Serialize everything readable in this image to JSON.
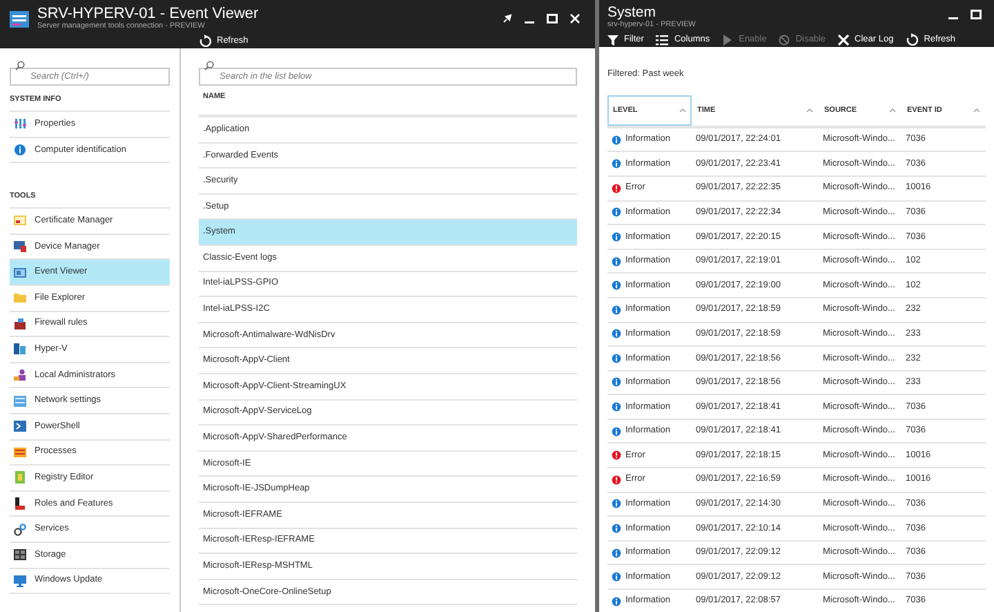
{
  "blade": {
    "title": "SRV-HYPERV-01 - Event Viewer",
    "subtitle": "Server management tools connection - PREVIEW",
    "toolbar": [
      {
        "label": "Refresh",
        "kind": "refresh"
      }
    ]
  },
  "sidebar": {
    "search_placeholder": "Search (Ctrl+/)",
    "sections": [
      {
        "heading": "SYSTEM INFO",
        "items": [
          {
            "label": "Properties",
            "kind": "properties",
            "selected": false
          },
          {
            "label": "Computer identification",
            "kind": "info",
            "selected": false
          }
        ]
      },
      {
        "heading": "TOOLS",
        "items": [
          {
            "label": "Certificate Manager",
            "kind": "certificate",
            "selected": false
          },
          {
            "label": "Device Manager",
            "kind": "device",
            "selected": false
          },
          {
            "label": "Event Viewer",
            "kind": "event",
            "selected": true
          },
          {
            "label": "File Explorer",
            "kind": "folder",
            "selected": false
          },
          {
            "label": "Firewall rules",
            "kind": "firewall",
            "selected": false
          },
          {
            "label": "Hyper-V",
            "kind": "hyperv",
            "selected": false
          },
          {
            "label": "Local Administrators",
            "kind": "users",
            "selected": false
          },
          {
            "label": "Network settings",
            "kind": "network",
            "selected": false
          },
          {
            "label": "PowerShell",
            "kind": "powershell",
            "selected": false
          },
          {
            "label": "Processes",
            "kind": "processes",
            "selected": false
          },
          {
            "label": "Registry Editor",
            "kind": "registry",
            "selected": false
          },
          {
            "label": "Roles and Features",
            "kind": "roles",
            "selected": false
          },
          {
            "label": "Services",
            "kind": "services",
            "selected": false
          },
          {
            "label": "Storage",
            "kind": "storage",
            "selected": false
          },
          {
            "label": "Windows Update",
            "kind": "update",
            "selected": false
          }
        ]
      }
    ]
  },
  "logs": {
    "search_placeholder": "Search in the list below",
    "column": "NAME",
    "items": [
      {
        "label": ".Application",
        "selected": false
      },
      {
        "label": ".Forwarded Events",
        "selected": false
      },
      {
        "label": ".Security",
        "selected": false
      },
      {
        "label": ".Setup",
        "selected": false
      },
      {
        "label": ".System",
        "selected": true
      },
      {
        "label": "Classic-Event logs",
        "selected": false
      },
      {
        "label": "Intel-iaLPSS-GPIO",
        "selected": false
      },
      {
        "label": "Intel-iaLPSS-I2C",
        "selected": false
      },
      {
        "label": "Microsoft-Antimalware-WdNisDrv",
        "selected": false
      },
      {
        "label": "Microsoft-AppV-Client",
        "selected": false
      },
      {
        "label": "Microsoft-AppV-Client-StreamingUX",
        "selected": false
      },
      {
        "label": "Microsoft-AppV-ServiceLog",
        "selected": false
      },
      {
        "label": "Microsoft-AppV-SharedPerformance",
        "selected": false
      },
      {
        "label": "Microsoft-IE",
        "selected": false
      },
      {
        "label": "Microsoft-IE-JSDumpHeap",
        "selected": false
      },
      {
        "label": "Microsoft-IEFRAME",
        "selected": false
      },
      {
        "label": "Microsoft-IEResp-IEFRAME",
        "selected": false
      },
      {
        "label": "Microsoft-IEResp-MSHTML",
        "selected": false
      },
      {
        "label": "Microsoft-OneCore-OnlineSetup",
        "selected": false
      }
    ]
  },
  "system": {
    "title": "System",
    "subtitle": "srv-hyperv-01 - PREVIEW",
    "toolbar": [
      {
        "label": "Filter",
        "kind": "filter",
        "disabled": false
      },
      {
        "label": "Columns",
        "kind": "columns",
        "disabled": false
      },
      {
        "label": "Enable",
        "kind": "play",
        "disabled": true
      },
      {
        "label": "Disable",
        "kind": "block",
        "disabled": true
      },
      {
        "label": "Clear Log",
        "kind": "close",
        "disabled": false
      },
      {
        "label": "Refresh",
        "kind": "refresh",
        "disabled": false
      }
    ],
    "filter_text": "Filtered: Past week",
    "columns": [
      {
        "label": "LEVEL",
        "focused": true
      },
      {
        "label": "TIME",
        "focused": false
      },
      {
        "label": "SOURCE",
        "focused": false
      },
      {
        "label": "EVENT ID",
        "focused": false
      }
    ],
    "rows": [
      {
        "kind": "information",
        "level": "Information",
        "time": "09/01/2017, 22:24:01",
        "source": "Microsoft-Windo...",
        "event_id": "7036"
      },
      {
        "kind": "information",
        "level": "Information",
        "time": "09/01/2017, 22:23:41",
        "source": "Microsoft-Windo...",
        "event_id": "7036"
      },
      {
        "kind": "error",
        "level": "Error",
        "time": "09/01/2017, 22:22:35",
        "source": "Microsoft-Windo...",
        "event_id": "10016"
      },
      {
        "kind": "information",
        "level": "Information",
        "time": "09/01/2017, 22:22:34",
        "source": "Microsoft-Windo...",
        "event_id": "7036"
      },
      {
        "kind": "information",
        "level": "Information",
        "time": "09/01/2017, 22:20:15",
        "source": "Microsoft-Windo...",
        "event_id": "7036"
      },
      {
        "kind": "information",
        "level": "Information",
        "time": "09/01/2017, 22:19:01",
        "source": "Microsoft-Windo...",
        "event_id": "102"
      },
      {
        "kind": "information",
        "level": "Information",
        "time": "09/01/2017, 22:19:00",
        "source": "Microsoft-Windo...",
        "event_id": "102"
      },
      {
        "kind": "information",
        "level": "Information",
        "time": "09/01/2017, 22:18:59",
        "source": "Microsoft-Windo...",
        "event_id": "232"
      },
      {
        "kind": "information",
        "level": "Information",
        "time": "09/01/2017, 22:18:59",
        "source": "Microsoft-Windo...",
        "event_id": "233"
      },
      {
        "kind": "information",
        "level": "Information",
        "time": "09/01/2017, 22:18:56",
        "source": "Microsoft-Windo...",
        "event_id": "232"
      },
      {
        "kind": "information",
        "level": "Information",
        "time": "09/01/2017, 22:18:56",
        "source": "Microsoft-Windo...",
        "event_id": "233"
      },
      {
        "kind": "information",
        "level": "Information",
        "time": "09/01/2017, 22:18:41",
        "source": "Microsoft-Windo...",
        "event_id": "7036"
      },
      {
        "kind": "information",
        "level": "Information",
        "time": "09/01/2017, 22:18:41",
        "source": "Microsoft-Windo...",
        "event_id": "7036"
      },
      {
        "kind": "error",
        "level": "Error",
        "time": "09/01/2017, 22:18:15",
        "source": "Microsoft-Windo...",
        "event_id": "10016"
      },
      {
        "kind": "error",
        "level": "Error",
        "time": "09/01/2017, 22:16:59",
        "source": "Microsoft-Windo...",
        "event_id": "10016"
      },
      {
        "kind": "information",
        "level": "Information",
        "time": "09/01/2017, 22:14:30",
        "source": "Microsoft-Windo...",
        "event_id": "7036"
      },
      {
        "kind": "information",
        "level": "Information",
        "time": "09/01/2017, 22:10:14",
        "source": "Microsoft-Windo...",
        "event_id": "7036"
      },
      {
        "kind": "information",
        "level": "Information",
        "time": "09/01/2017, 22:09:12",
        "source": "Microsoft-Windo...",
        "event_id": "7036"
      },
      {
        "kind": "information",
        "level": "Information",
        "time": "09/01/2017, 22:09:12",
        "source": "Microsoft-Windo...",
        "event_id": "7036"
      },
      {
        "kind": "information",
        "level": "Information",
        "time": "09/01/2017, 22:08:57",
        "source": "Microsoft-Windo...",
        "event_id": "7036"
      }
    ]
  }
}
